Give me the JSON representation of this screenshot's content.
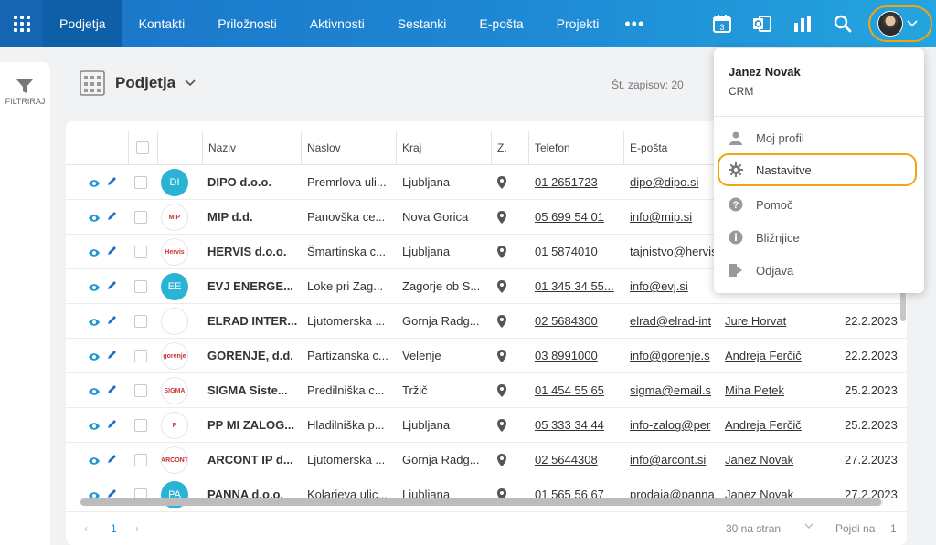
{
  "nav": {
    "items": [
      "Podjetja",
      "Kontakti",
      "Priložnosti",
      "Aktivnosti",
      "Sestanki",
      "E-pošta",
      "Projekti"
    ],
    "more": "•••",
    "calendar_day": "3"
  },
  "sidebar": {
    "filter_label": "FILTRIRAJ"
  },
  "page": {
    "title": "Podjetja",
    "records_label": "Št. zapisov: 20"
  },
  "table": {
    "columns": [
      "Naziv",
      "Naslov",
      "Kraj",
      "Z.",
      "Telefon",
      "E-pošta"
    ],
    "rows": [
      {
        "logo": "DI",
        "logo_color": "#2bb3d6",
        "name": "DIPO d.o.o.",
        "address": "Premrlova uli...",
        "city": "Ljubljana",
        "phone": "01 2651723",
        "email": "dipo@dipo.si",
        "contact": "",
        "date": ""
      },
      {
        "logo": "MIP",
        "logo_color": "#ffffff",
        "name": "MIP d.d.",
        "address": "Panovška ce...",
        "city": "Nova Gorica",
        "phone": "05 699 54 01",
        "email": "info@mip.si",
        "contact": "",
        "date": ""
      },
      {
        "logo": "Hervis",
        "logo_color": "#ffffff",
        "name": "HERVIS d.o.o.",
        "address": "Šmartinska c...",
        "city": "Ljubljana",
        "phone": "01 5874010",
        "email": "tajnistvo@hervis",
        "contact": "",
        "date": ""
      },
      {
        "logo": "EE",
        "logo_color": "#2bb3d6",
        "name": "EVJ ENERGE...",
        "address": "Loke pri Zag...",
        "city": "Zagorje ob S...",
        "phone": "01 345 34 55...",
        "email": "info@evj.si",
        "contact": "",
        "date": ""
      },
      {
        "logo": "",
        "logo_color": "#ffffff",
        "name": "ELRAD INTER...",
        "address": "Ljutomerska ...",
        "city": "Gornja Radg...",
        "phone": "02 5684300",
        "email": "elrad@elrad-int",
        "contact": "Jure Horvat",
        "date": "22.2.2023"
      },
      {
        "logo": "gorenje",
        "logo_color": "#ffffff",
        "name": "GORENJE, d.d.",
        "address": "Partizanska c...",
        "city": "Velenje",
        "phone": "03 8991000",
        "email": "info@gorenje.s",
        "contact": "Andreja Ferčič",
        "date": "22.2.2023"
      },
      {
        "logo": "SIGMA",
        "logo_color": "#ffffff",
        "name": "SIGMA Siste...",
        "address": "Predilniška c...",
        "city": "Tržič",
        "phone": "01 454 55 65",
        "email": "sigma@email.s",
        "contact": "Miha Petek",
        "date": "25.2.2023"
      },
      {
        "logo": "P",
        "logo_color": "#ffffff",
        "name": "PP MI ZALOG...",
        "address": "Hladilniška p...",
        "city": "Ljubljana",
        "phone": "05 333 34 44",
        "email": "info-zalog@per",
        "contact": "Andreja Ferčič",
        "date": "25.2.2023"
      },
      {
        "logo": "ARCONT",
        "logo_color": "#ffffff",
        "name": "ARCONT IP d...",
        "address": "Ljutomerska ...",
        "city": "Gornja Radg...",
        "phone": "02 5644308",
        "email": "info@arcont.si",
        "contact": "Janez Novak",
        "date": "27.2.2023"
      },
      {
        "logo": "PA",
        "logo_color": "#2bb3d6",
        "name": "PANNA d.o.o.",
        "address": "Kolarjeva ulic...",
        "city": "Ljubljana",
        "phone": "01 565 56 67",
        "email": "prodaja@panna",
        "contact": "Janez Novak",
        "date": "27.2.2023"
      }
    ]
  },
  "pagination": {
    "prev": "‹",
    "page": "1",
    "next": "›",
    "per_page": "30 na stran",
    "goto_label": "Pojdi na",
    "goto_value": "1"
  },
  "user_menu": {
    "name": "Janez Novak",
    "subtitle": "CRM",
    "items": [
      {
        "label": "Moj profil",
        "icon": "user-icon"
      },
      {
        "label": "Nastavitve",
        "icon": "gear-icon"
      },
      {
        "label": "Pomoč",
        "icon": "help-icon"
      },
      {
        "label": "Bližnjice",
        "icon": "info-icon"
      },
      {
        "label": "Odjava",
        "icon": "logout-icon"
      }
    ]
  },
  "colors": {
    "nav_start": "#1a73c7",
    "nav_end": "#24a5df",
    "accent": "#1e88d4",
    "highlight": "#f2a413"
  }
}
